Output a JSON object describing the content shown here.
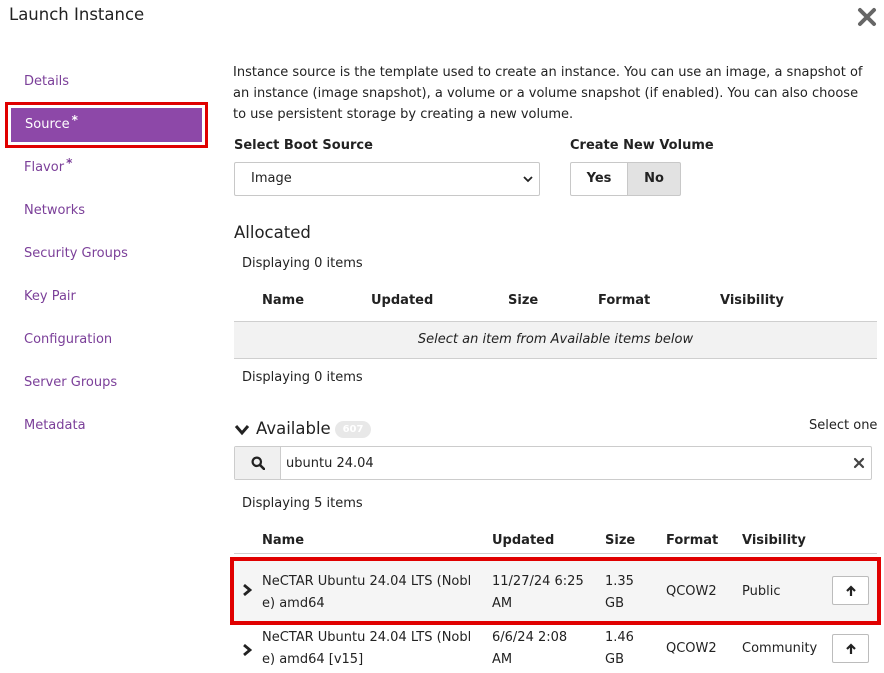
{
  "modal": {
    "title": "Launch Instance"
  },
  "sidebar": {
    "items": [
      {
        "label": "Details",
        "required": ""
      },
      {
        "label": "Source",
        "required": "*"
      },
      {
        "label": "Flavor",
        "required": "*"
      },
      {
        "label": "Networks",
        "required": ""
      },
      {
        "label": "Security Groups",
        "required": ""
      },
      {
        "label": "Key Pair",
        "required": ""
      },
      {
        "label": "Configuration",
        "required": ""
      },
      {
        "label": "Server Groups",
        "required": ""
      },
      {
        "label": "Metadata",
        "required": ""
      }
    ]
  },
  "source": {
    "intro": "Instance source is the template used to create an instance. You can use an image, a snapshot of an instance (image snapshot), a volume or a volume snapshot (if enabled). You can also choose to use persistent storage by creating a new volume.",
    "boot_source_label": "Select Boot Source",
    "boot_source_value": "Image",
    "create_volume_label": "Create New Volume",
    "yes_label": "Yes",
    "no_label": "No",
    "create_volume_selected": "No"
  },
  "allocated": {
    "title": "Allocated",
    "displaying_top": "Displaying 0 items",
    "displaying_bottom": "Displaying 0 items",
    "columns": [
      "Name",
      "Updated",
      "Size",
      "Format",
      "Visibility"
    ],
    "empty_message": "Select an item from Available items below"
  },
  "available": {
    "title": "Available",
    "count": "607",
    "select_hint": "Select one",
    "search_value": "ubuntu 24.04",
    "displaying": "Displaying 5 items",
    "columns": [
      "Name",
      "Updated",
      "Size",
      "Format",
      "Visibility"
    ],
    "rows": [
      {
        "name_l1": "NeCTAR Ubuntu 24.04 LTS (Nobl",
        "name_l2": "e) amd64",
        "updated_l1": "11/27/24 6:25",
        "updated_l2": "AM",
        "size_l1": "1.35",
        "size_l2": "GB",
        "format": "QCOW2",
        "visibility": "Public"
      },
      {
        "name_l1": "NeCTAR Ubuntu 24.04 LTS (Nobl",
        "name_l2": "e) amd64 [v15]",
        "updated_l1": "6/6/24 2:08",
        "updated_l2": "AM",
        "size_l1": "1.46",
        "size_l2": "GB",
        "format": "QCOW2",
        "visibility": "Community"
      }
    ]
  },
  "colors": {
    "accent": "#8d48a8",
    "nav_text": "#7b3f99",
    "highlight": "#e00000"
  }
}
